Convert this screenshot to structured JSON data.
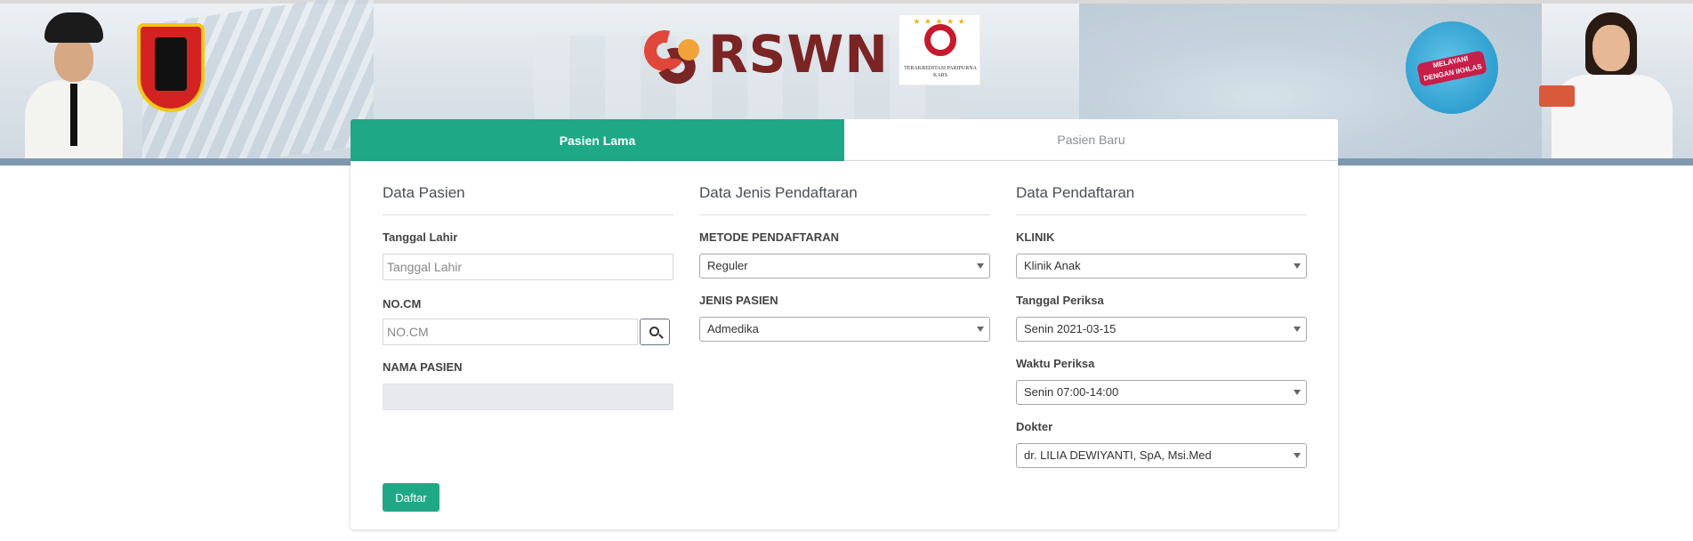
{
  "header": {
    "brand": "RSWN",
    "accreditation_caption": "TERAKREDITASI PARIPURNA KARS",
    "slogan": "MELAYANI DENGAN IKHLAS",
    "icons": [
      "official-portrait",
      "semarang-crest",
      "rswn-logo",
      "kars-logo",
      "slogan-badge",
      "doctor-portrait"
    ]
  },
  "tabs": [
    {
      "label": "Pasien Lama",
      "active": true
    },
    {
      "label": "Pasien Baru",
      "active": false
    }
  ],
  "data_pasien": {
    "title": "Data Pasien",
    "tanggal_lahir_label": "Tanggal Lahir",
    "tanggal_lahir_placeholder": "Tanggal Lahir",
    "tanggal_lahir_value": "",
    "nocm_label": "NO.CM",
    "nocm_placeholder": "NO.CM",
    "nocm_value": "",
    "nama_label": "NAMA PASIEN",
    "nama_value": ""
  },
  "data_jenis": {
    "title": "Data Jenis Pendaftaran",
    "metode_label": "METODE PENDAFTARAN",
    "metode_value": "Reguler",
    "jenis_label": "JENIS PASIEN",
    "jenis_value": "Admedika"
  },
  "data_pendaftaran": {
    "title": "Data Pendaftaran",
    "klinik_label": "KLINIK",
    "klinik_value": "Klinik Anak",
    "tanggal_label": "Tanggal Periksa",
    "tanggal_value": "Senin 2021-03-15",
    "waktu_label": "Waktu Periksa",
    "waktu_value": "Senin 07:00-14:00",
    "dokter_label": "Dokter",
    "dokter_value": "dr. LILIA DEWIYANTI, SpA, Msi.Med"
  },
  "actions": {
    "daftar_label": "Daftar"
  },
  "colors": {
    "primary": "#1fa886",
    "brand": "#7a2424",
    "tab_inactive_text": "#8a8f94"
  }
}
